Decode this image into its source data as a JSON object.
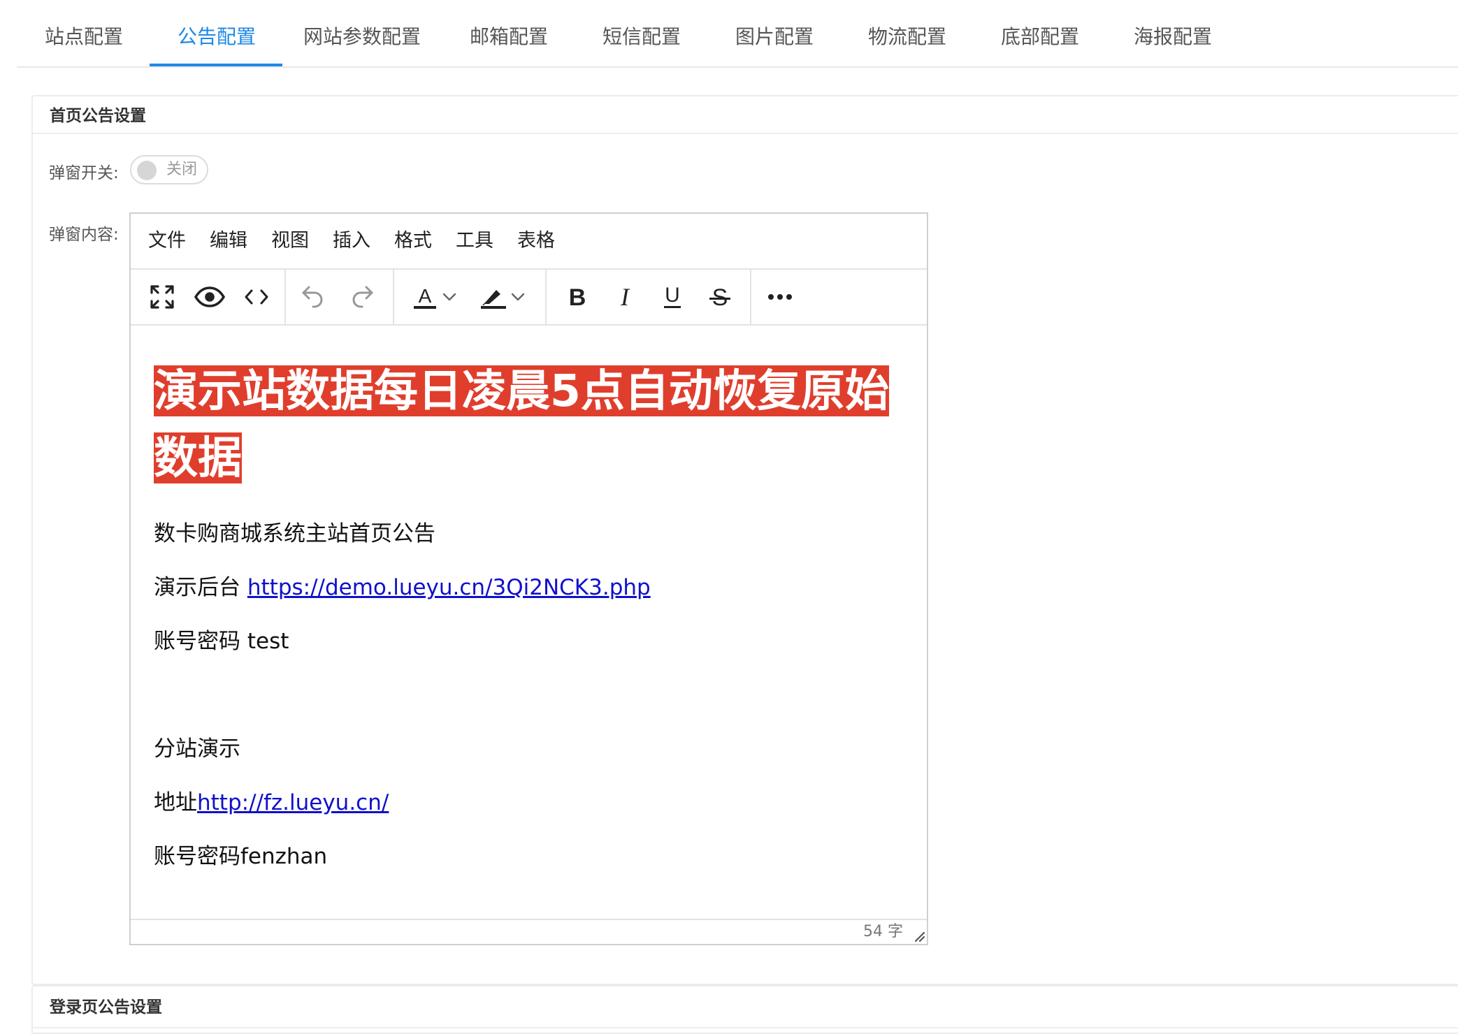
{
  "tabs": [
    {
      "label": "站点配置",
      "active": false
    },
    {
      "label": "公告配置",
      "active": true
    },
    {
      "label": "网站参数配置",
      "active": false
    },
    {
      "label": "邮箱配置",
      "active": false
    },
    {
      "label": "短信配置",
      "active": false
    },
    {
      "label": "图片配置",
      "active": false
    },
    {
      "label": "物流配置",
      "active": false
    },
    {
      "label": "底部配置",
      "active": false
    },
    {
      "label": "海报配置",
      "active": false
    }
  ],
  "accent_color": "#1e88e5",
  "home_section": {
    "title": "首页公告设置",
    "popup_switch_label": "弹窗开关:",
    "popup_switch_state": "关闭",
    "popup_content_label": "弹窗内容:"
  },
  "editor": {
    "menus": [
      "文件",
      "编辑",
      "视图",
      "插入",
      "格式",
      "工具",
      "表格"
    ],
    "toolbar_icons": [
      "fullscreen-icon",
      "preview-icon",
      "source-code-icon",
      "undo-icon",
      "redo-icon",
      "text-color-icon",
      "highlight-color-icon",
      "bold-icon",
      "italic-icon",
      "underline-icon",
      "strikethrough-icon",
      "more-icon"
    ],
    "headline": {
      "text": "演示站数据每日凌晨5点自动恢复原始数据",
      "bg_color": "#e03e2d"
    },
    "p1": "数卡购商城系统主站首页公告",
    "p2_prefix": "演示后台 ",
    "p2_link": "https://demo.lueyu.cn/3Qi2NCK3.php",
    "p3": "账号密码 test",
    "p4": "分站演示",
    "p5_prefix": "地址",
    "p5_link": "http://fz.lueyu.cn/",
    "p6": "账号密码fenzhan",
    "word_count": "54 字"
  },
  "login_section": {
    "title": "登录页公告设置"
  }
}
